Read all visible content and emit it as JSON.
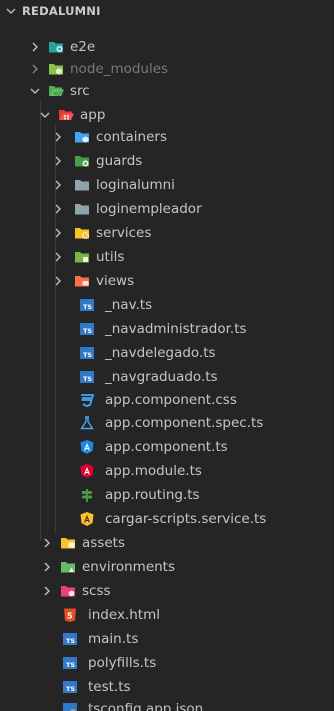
{
  "explorer": {
    "section_title": "REDALUMNI",
    "items": [
      {
        "label": "e2e",
        "icon": "folder-e2e-icon",
        "expandable": true,
        "expanded": false
      },
      {
        "label": "node_modules",
        "icon": "folder-node-icon",
        "expandable": true,
        "expanded": false,
        "dimmed": true
      },
      {
        "label": "src",
        "icon": "folder-src-open-icon",
        "expandable": true,
        "expanded": true
      },
      {
        "label": "app",
        "icon": "folder-app-open-icon",
        "expandable": true,
        "expanded": true
      },
      {
        "label": "containers",
        "icon": "folder-containers-icon",
        "expandable": true,
        "expanded": false
      },
      {
        "label": "guards",
        "icon": "folder-guards-icon",
        "expandable": true,
        "expanded": false
      },
      {
        "label": "loginalumni",
        "icon": "folder-icon",
        "expandable": true,
        "expanded": false
      },
      {
        "label": "loginempleador",
        "icon": "folder-icon",
        "expandable": true,
        "expanded": false
      },
      {
        "label": "services",
        "icon": "folder-services-icon",
        "expandable": true,
        "expanded": false
      },
      {
        "label": "utils",
        "icon": "folder-utils-icon",
        "expandable": true,
        "expanded": false
      },
      {
        "label": "views",
        "icon": "folder-views-icon",
        "expandable": true,
        "expanded": false
      },
      {
        "label": "_nav.ts",
        "icon": "typescript-icon"
      },
      {
        "label": "_navadministrador.ts",
        "icon": "typescript-icon"
      },
      {
        "label": "_navdelegado.ts",
        "icon": "typescript-icon"
      },
      {
        "label": "_navgraduado.ts",
        "icon": "typescript-icon"
      },
      {
        "label": "app.component.css",
        "icon": "css-icon"
      },
      {
        "label": "app.component.spec.ts",
        "icon": "test-flask-icon"
      },
      {
        "label": "app.component.ts",
        "icon": "angular-component-icon"
      },
      {
        "label": "app.module.ts",
        "icon": "angular-module-icon"
      },
      {
        "label": "app.routing.ts",
        "icon": "routing-icon"
      },
      {
        "label": "cargar-scripts.service.ts",
        "icon": "angular-service-icon"
      },
      {
        "label": "assets",
        "icon": "folder-assets-icon",
        "expandable": true,
        "expanded": false
      },
      {
        "label": "environments",
        "icon": "folder-environments-icon",
        "expandable": true,
        "expanded": false
      },
      {
        "label": "scss",
        "icon": "folder-scss-icon",
        "expandable": true,
        "expanded": false
      },
      {
        "label": "index.html",
        "icon": "html-icon"
      },
      {
        "label": "main.ts",
        "icon": "typescript-icon"
      },
      {
        "label": "polyfills.ts",
        "icon": "typescript-icon"
      },
      {
        "label": "test.ts",
        "icon": "typescript-icon"
      },
      {
        "label": "tsconfig.app.json",
        "icon": "tsconfig-icon"
      }
    ]
  },
  "colors": {
    "background": "#252526",
    "text": "#c5c5c5",
    "dim_text": "#7a7a7a",
    "typescript": "#3178c6",
    "angular": "#dd0031",
    "folder": "#90a4ae"
  }
}
